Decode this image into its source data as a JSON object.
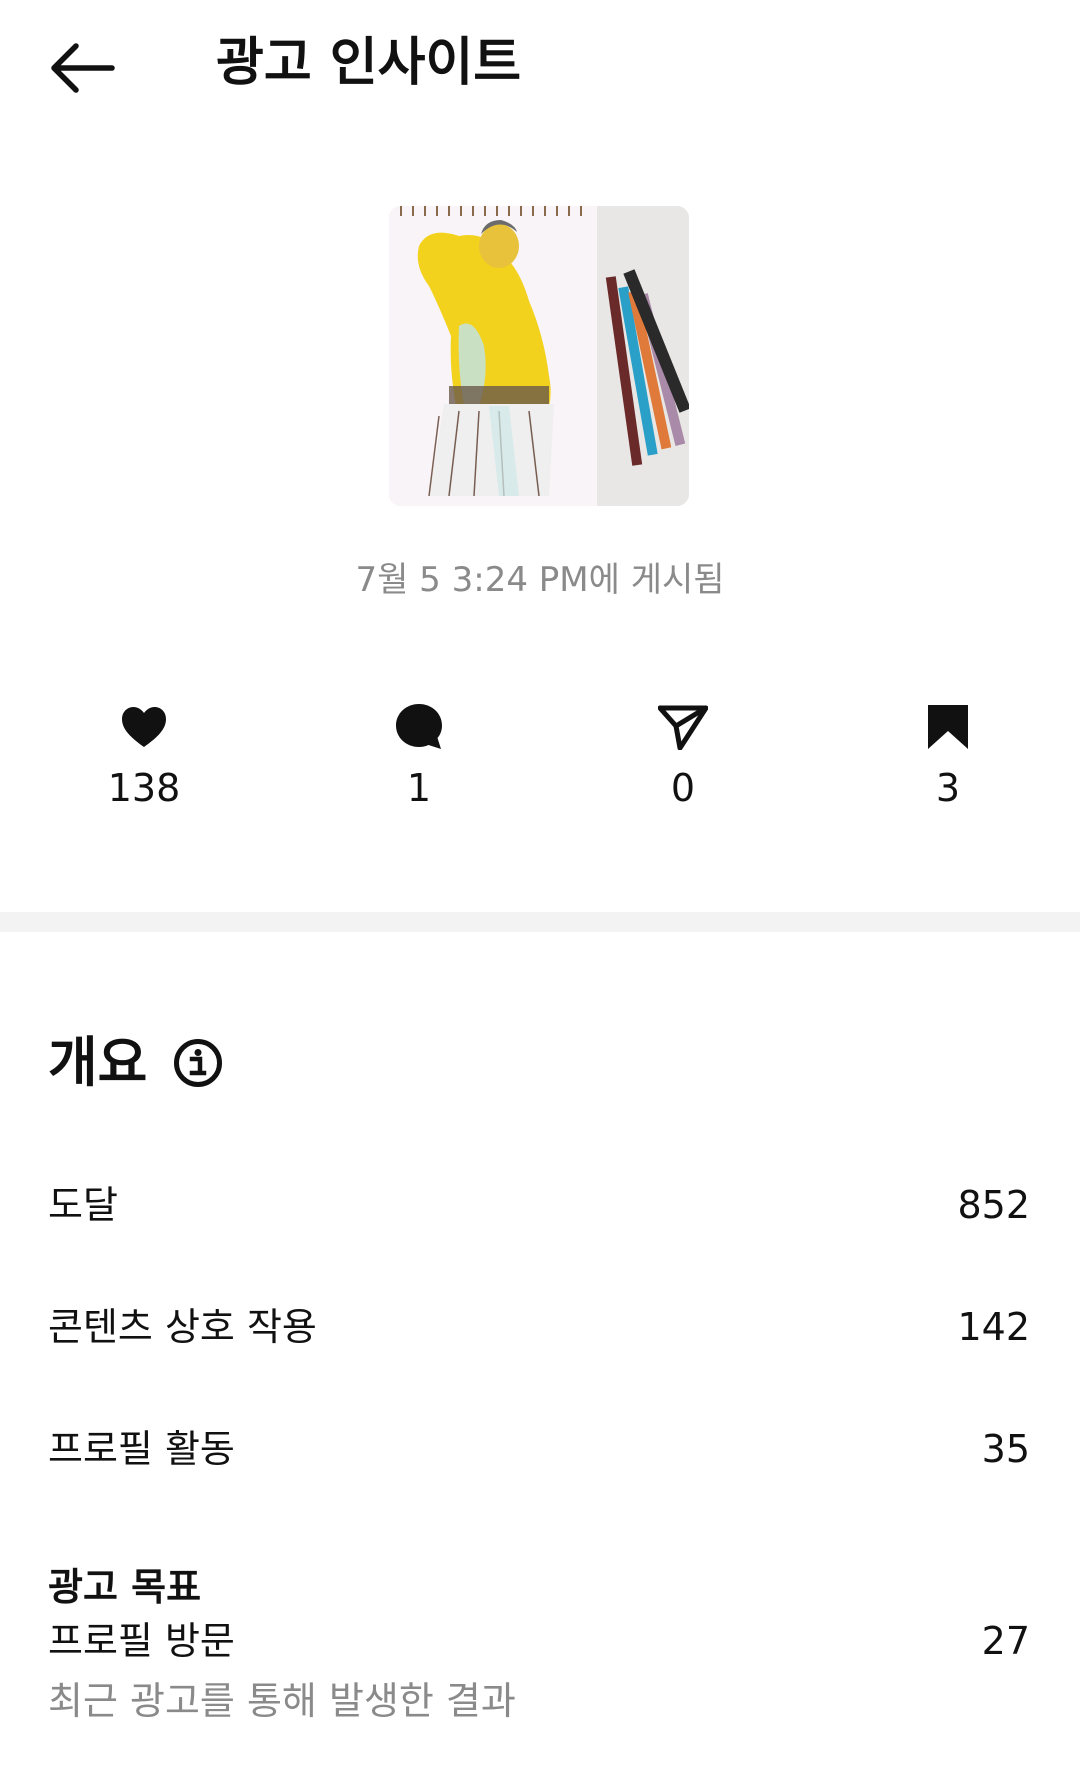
{
  "header": {
    "title": "광고 인사이트"
  },
  "post": {
    "posted_text": "7월 5 3:24 PM에 게시됨",
    "thumbnail_icon": "sketch-thumbnail"
  },
  "stats": [
    {
      "icon": "heart-icon",
      "count": "138"
    },
    {
      "icon": "comment-icon",
      "count": "1"
    },
    {
      "icon": "share-icon",
      "count": "0"
    },
    {
      "icon": "bookmark-icon",
      "count": "3"
    }
  ],
  "overview": {
    "title": "개요",
    "metrics": [
      {
        "label": "도달",
        "value": "852"
      },
      {
        "label": "콘텐츠 상호 작용",
        "value": "142"
      },
      {
        "label": "프로필 활동",
        "value": "35"
      }
    ]
  },
  "ad_goal": {
    "title": "광고 목표",
    "label": "프로필 방문",
    "value": "27",
    "subtitle": "최근 광고를 통해 발생한 결과"
  }
}
